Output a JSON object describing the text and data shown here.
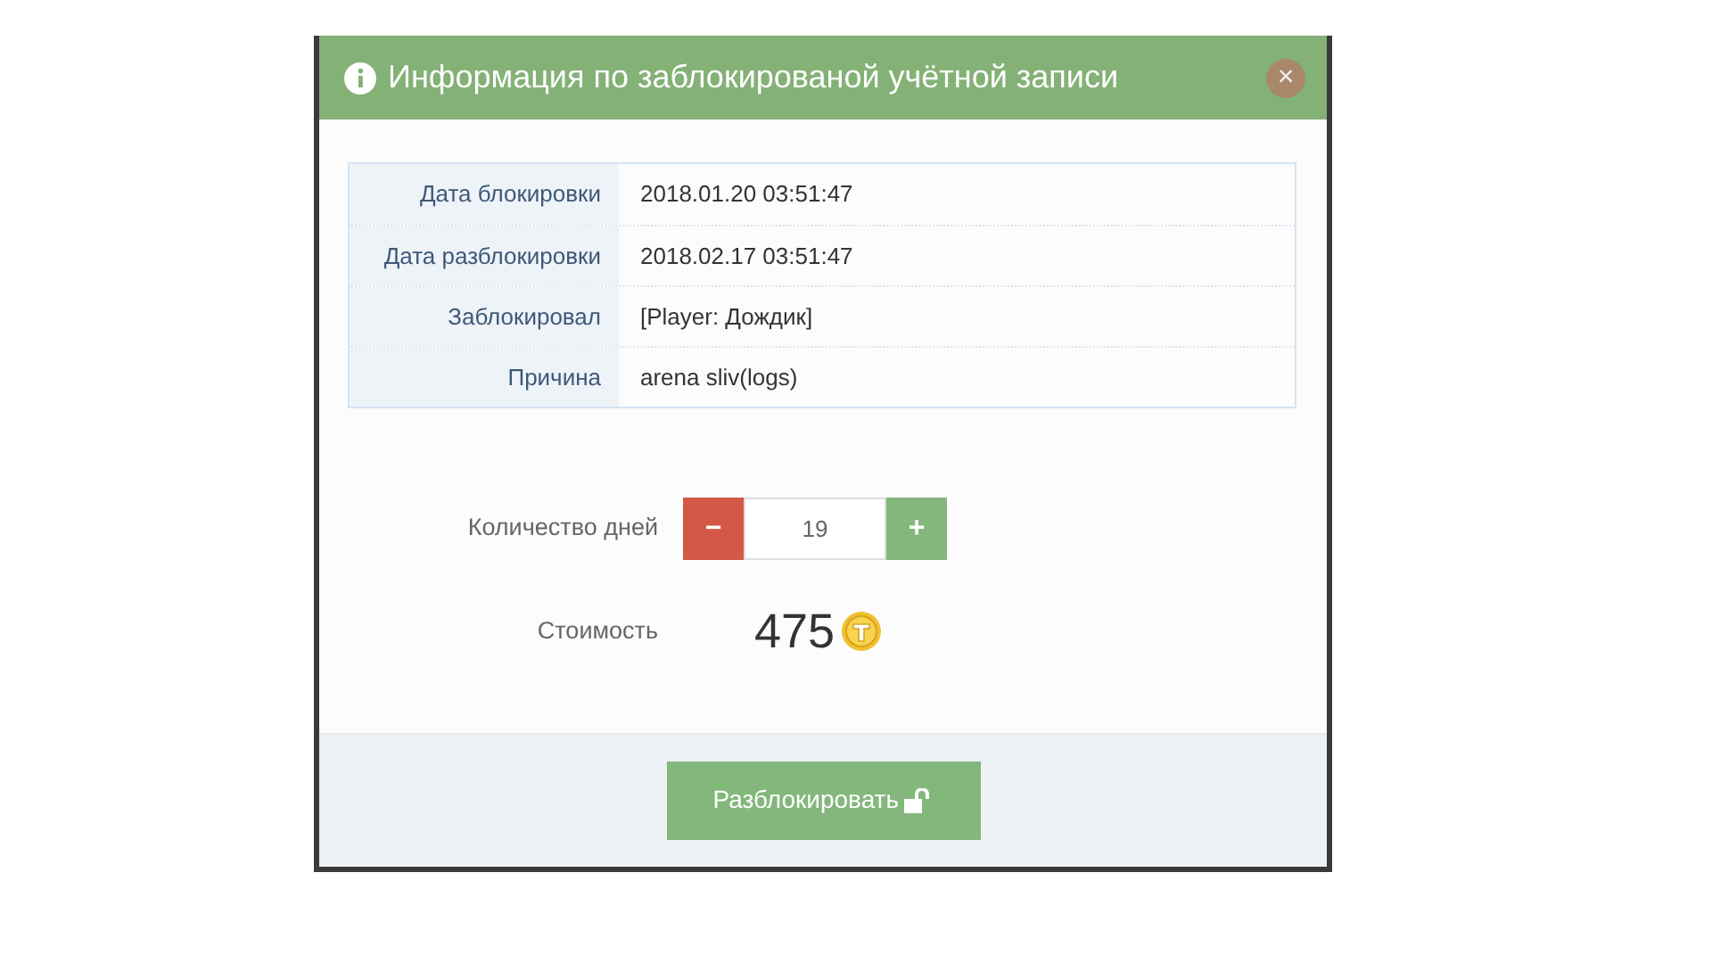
{
  "modal": {
    "title": "Информация по заблокированой учётной записи",
    "close": "×"
  },
  "details": [
    {
      "label": "Дата блокировки",
      "value": "2018.01.20 03:51:47"
    },
    {
      "label": "Дата разблокировки",
      "value": "2018.02.17 03:51:47"
    },
    {
      "label": "Заблокировал",
      "value": "[Player: Дождик]"
    },
    {
      "label": "Причина",
      "value": "arena sliv(logs)"
    }
  ],
  "days": {
    "label": "Количество дней",
    "minus": "−",
    "value": "19",
    "plus": "+"
  },
  "cost": {
    "label": "Стоимость",
    "value": "475"
  },
  "button": "Разблокировать"
}
